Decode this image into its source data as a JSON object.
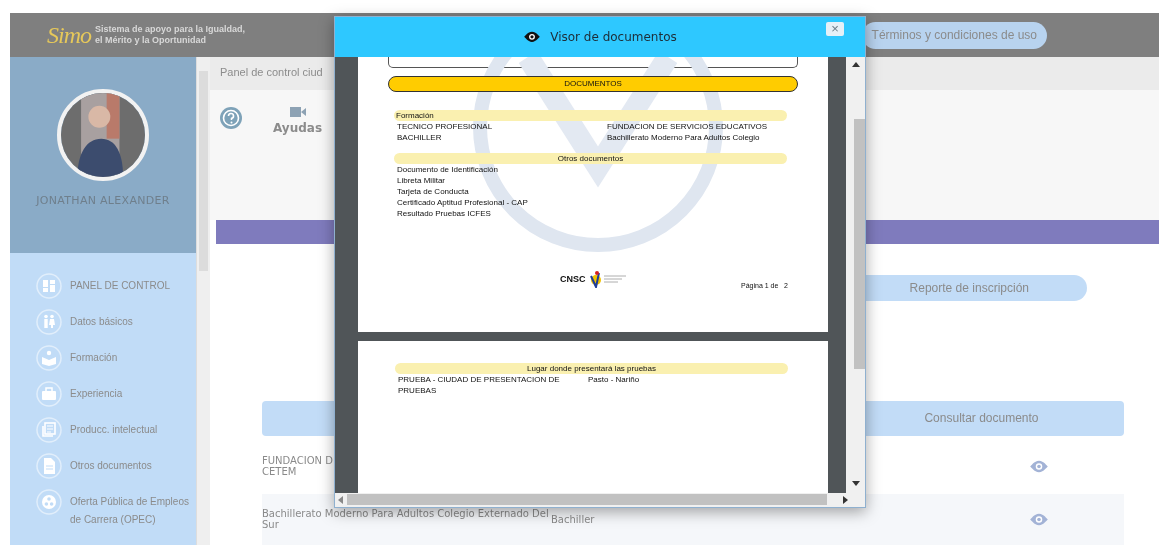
{
  "header": {
    "logo_text": "Simo",
    "tagline": [
      "Sistema de apoyo para la Igualdad,",
      "el Mérito y la Oportunidad"
    ],
    "terms_button": "Términos y condiciones de uso"
  },
  "profile": {
    "name": "JONATHAN ALEXANDER"
  },
  "sidebar": {
    "items": [
      {
        "label": "PANEL DE CONTROL"
      },
      {
        "label": "Datos básicos"
      },
      {
        "label": "Formación"
      },
      {
        "label": "Experiencia"
      },
      {
        "label": "Producc. intelectual"
      },
      {
        "label": "Otros documentos"
      },
      {
        "label": "Oferta Pública de Empleos de Carrera (OPEC)"
      }
    ]
  },
  "panel": {
    "title": "Panel de control ciud",
    "help_label": "Ayudas"
  },
  "report_button": "Reporte de inscripción",
  "table": {
    "column_3": "Consultar documento",
    "rows": [
      {
        "column_1": [
          "FUNDACION D",
          "CETEM"
        ]
      },
      {
        "column_1": [
          "Bachillerato Moderno Para Adultos Colegio Externado Del Sur"
        ],
        "column_2": "Bachiller"
      }
    ]
  },
  "viewer": {
    "title": "Visor de documentos",
    "close": "×",
    "pages": [
      {
        "banner": "DOCUMENTOS",
        "sections": [
          {
            "title": "Formación",
            "kind": "label",
            "rows": [
              [
                "TECNICO PROFESIONAL",
                "FUNDACION DE SERVICIOS EDUCATIVOS"
              ],
              [
                "BACHILLER",
                "Bachillerato Moderno Para Adultos Colegio"
              ]
            ]
          },
          {
            "title": "Otros documentos",
            "kind": "heading",
            "rows": [
              [
                "Documento de Identificación"
              ],
              [
                "Libreta Militar"
              ],
              [
                "Tarjeta de Conducta"
              ],
              [
                "Certificado Aptitud Profesional - CAP"
              ],
              [
                "Resultado Pruebas ICFES"
              ]
            ]
          }
        ],
        "footer": {
          "logo": "CNSC",
          "page_label": "Página 1 de",
          "page_total": "2"
        }
      },
      {
        "sections": [
          {
            "title": "Lugar donde presentará las pruebas",
            "kind": "heading",
            "rows": [
              [
                "PRUEBA - CIUDAD DE PRESENTACION DE PRUEBAS",
                "Pasto - Nariño"
              ]
            ]
          }
        ]
      }
    ]
  }
}
